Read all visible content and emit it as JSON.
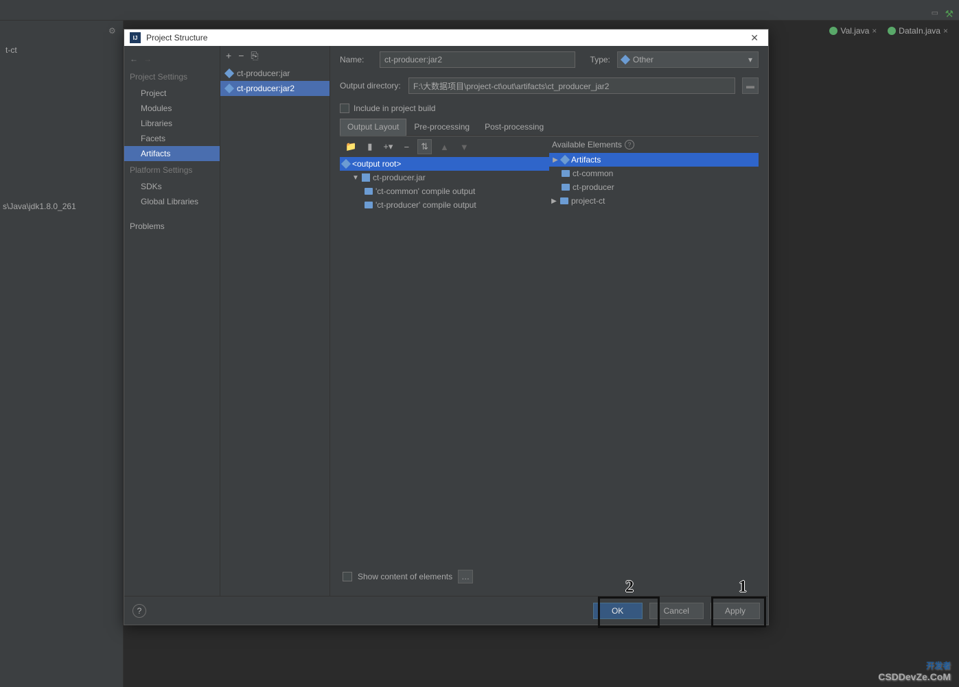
{
  "background": {
    "sidebar_item": "t-ct",
    "jdk_path": "s\\Java\\jdk1.8.0_261",
    "tabs": [
      {
        "label": "Val.java"
      },
      {
        "label": "DataIn.java"
      }
    ]
  },
  "dialog": {
    "title": "Project Structure",
    "sidebar": {
      "section1": "Project Settings",
      "items1": [
        "Project",
        "Modules",
        "Libraries",
        "Facets",
        "Artifacts"
      ],
      "section2": "Platform Settings",
      "items2": [
        "SDKs",
        "Global Libraries"
      ],
      "problems": "Problems"
    },
    "artifacts": [
      "ct-producer:jar",
      "ct-producer:jar2"
    ],
    "form": {
      "name_label": "Name:",
      "name_value": "ct-producer:jar2",
      "type_label": "Type:",
      "type_value": "Other",
      "output_label": "Output directory:",
      "output_value": "F:\\大数据项目\\project-ct\\out\\artifacts\\ct_producer_jar2",
      "include_label": "Include in project build"
    },
    "tabs": [
      "Output Layout",
      "Pre-processing",
      "Post-processing"
    ],
    "available_label": "Available Elements",
    "output_tree": {
      "root": "<output root>",
      "jar": "ct-producer.jar",
      "items": [
        "'ct-common' compile output",
        "'ct-producer' compile output"
      ]
    },
    "available_tree": {
      "root": "Artifacts",
      "items": [
        "ct-common",
        "ct-producer",
        "project-ct"
      ]
    },
    "show_content": "Show content of elements",
    "buttons": {
      "ok": "OK",
      "cancel": "Cancel",
      "apply": "Apply"
    }
  },
  "annotations": {
    "num1": "1",
    "num2": "2"
  },
  "watermark": {
    "line1": "开发者",
    "line2": "CSDDevZe.CoM"
  }
}
